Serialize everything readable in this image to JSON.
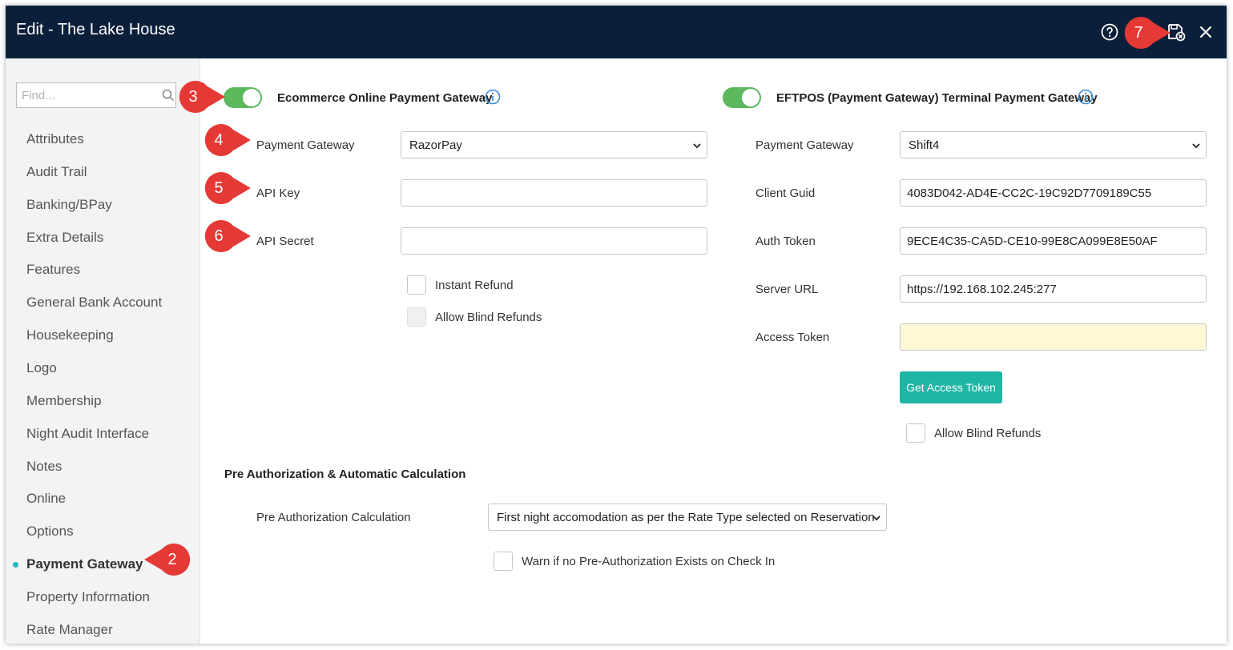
{
  "window": {
    "title": "Edit - The Lake House"
  },
  "titlebar_icons": {
    "help": "help-circle-icon",
    "save_close": "save-close-icon",
    "close": "close-icon"
  },
  "sidebar": {
    "search_placeholder": "Find...",
    "items": [
      {
        "label": "Attributes"
      },
      {
        "label": "Audit Trail"
      },
      {
        "label": "Banking/BPay"
      },
      {
        "label": "Extra Details"
      },
      {
        "label": "Features"
      },
      {
        "label": "General Bank Account"
      },
      {
        "label": "Housekeeping"
      },
      {
        "label": "Logo"
      },
      {
        "label": "Membership"
      },
      {
        "label": "Night Audit Interface"
      },
      {
        "label": "Notes"
      },
      {
        "label": "Online"
      },
      {
        "label": "Options"
      },
      {
        "label": "Payment Gateway"
      },
      {
        "label": "Property Information"
      },
      {
        "label": "Rate Manager"
      }
    ],
    "active_item": "Payment Gateway"
  },
  "ecommerce": {
    "enabled": true,
    "title": "Ecommerce Online Payment Gateway",
    "payment_gateway_label": "Payment Gateway",
    "payment_gateway_value": "RazorPay",
    "api_key_label": "API Key",
    "api_key_value": "",
    "api_secret_label": "API Secret",
    "api_secret_value": "",
    "instant_refund_label": "Instant Refund",
    "instant_refund_checked": false,
    "allow_blind_refunds_label": "Allow Blind Refunds",
    "allow_blind_refunds_checked": false
  },
  "eftpos": {
    "enabled": true,
    "title": "EFTPOS (Payment Gateway) Terminal Payment Gateway",
    "payment_gateway_label": "Payment Gateway",
    "payment_gateway_value": "Shift4",
    "client_guid_label": "Client Guid",
    "client_guid_value": "4083D042-AD4E-CC2C-19C92D7709189C55",
    "auth_token_label": "Auth Token",
    "auth_token_value": "9ECE4C35-CA5D-CE10-99E8CA099E8E50AF",
    "server_url_label": "Server URL",
    "server_url_value": "https://192.168.102.245:277",
    "access_token_label": "Access Token",
    "access_token_value": "",
    "get_access_token_button": "Get Access Token",
    "allow_blind_refunds_label": "Allow Blind Refunds",
    "allow_blind_refunds_checked": false
  },
  "preauth": {
    "section_title": "Pre Authorization & Automatic Calculation",
    "calculation_label": "Pre Authorization Calculation",
    "calculation_value": "First night accomodation as per the Rate Type selected on Reservation",
    "warn_label": "Warn if no Pre-Authorization Exists on Check In",
    "warn_checked": false
  },
  "callouts": [
    "2",
    "3",
    "4",
    "5",
    "6",
    "7"
  ],
  "colors": {
    "titlebar": "#0b1f3a",
    "toggle_on": "#5cb85c",
    "button": "#1fb5a5",
    "callout": "#e53935",
    "active_dot": "#22b8c4",
    "info": "#3b8fd9"
  }
}
